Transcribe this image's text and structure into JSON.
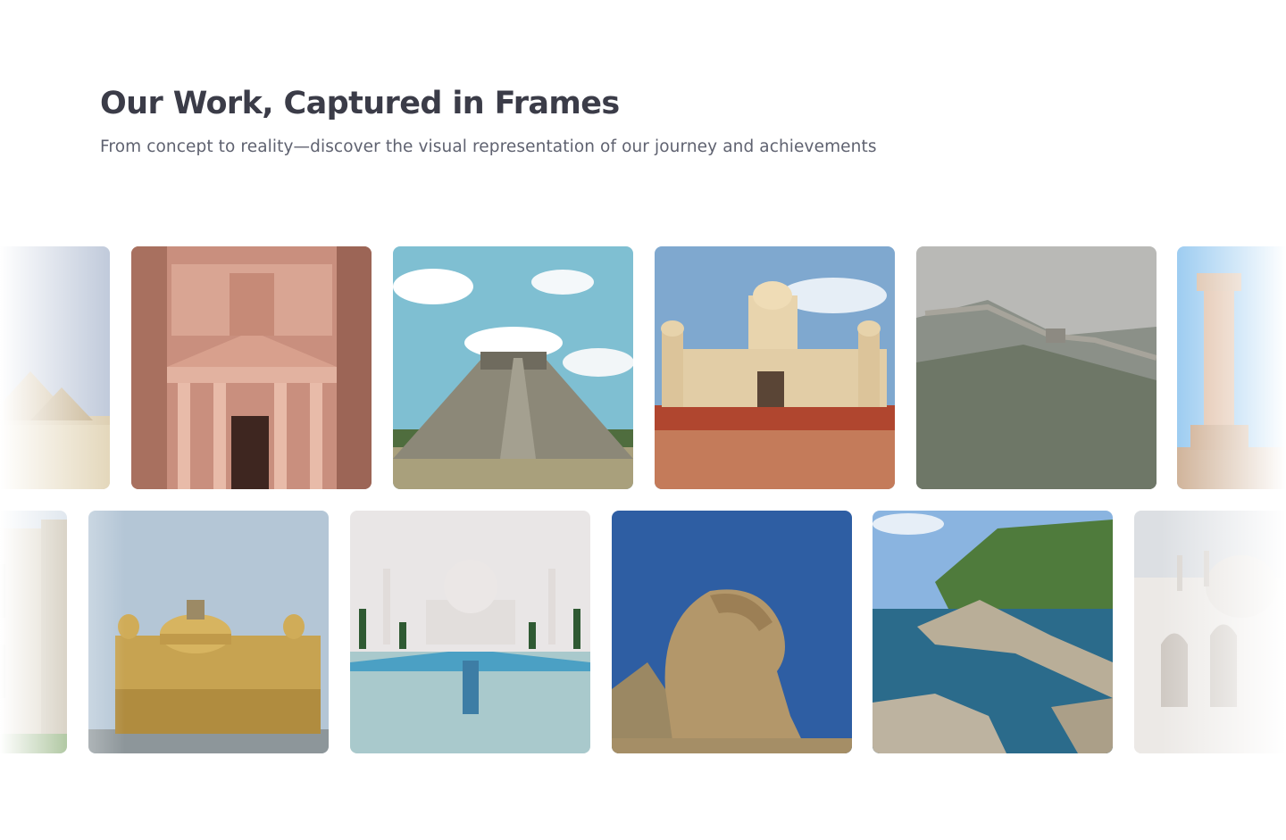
{
  "header": {
    "title": "Our Work, Captured in Frames",
    "subtitle": "From concept to reality—discover the visual representation of our journey and achievements"
  },
  "gallery": {
    "row1": [
      {
        "subject": "pyramids-of-giza"
      },
      {
        "subject": "petra-treasury"
      },
      {
        "subject": "chichen-itza-pyramid"
      },
      {
        "subject": "itimad-ud-daulah-tomb"
      },
      {
        "subject": "great-wall-of-china"
      },
      {
        "subject": "ancient-stone-column"
      }
    ],
    "row2": [
      {
        "subject": "gothic-cathedral"
      },
      {
        "subject": "golden-temple"
      },
      {
        "subject": "taj-mahal"
      },
      {
        "subject": "great-sphinx"
      },
      {
        "subject": "rocky-coastline"
      },
      {
        "subject": "taj-mahal-detail"
      }
    ]
  }
}
